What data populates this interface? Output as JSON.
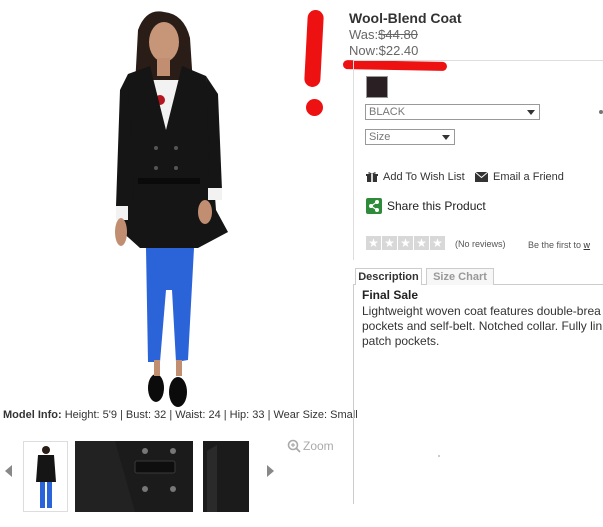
{
  "product": {
    "title": "Wool-Blend Coat",
    "was_label": "Was:",
    "was_price": "$44.80",
    "now_label": "Now:",
    "now_price": "$22.40",
    "color_select": "BLACK",
    "size_select": "Size",
    "add_to_wishlist": "Add To Wish List",
    "email_friend": "Email a Friend",
    "share": "Share this Product",
    "rating_stars": 0,
    "reviews": "(No reviews)",
    "first_to_prefix": "Be the first to",
    "first_to_link": "w"
  },
  "model_info": {
    "label": "Model Info:",
    "text": "Height: 5'9 | Bust: 32 | Waist: 24 | Hip: 33 | Wear Size: Small"
  },
  "gallery": {
    "zoom_label": "Zoom"
  },
  "tabs": [
    {
      "label": "Description",
      "active": true
    },
    {
      "label": "Size Chart",
      "active": false
    }
  ],
  "description": {
    "heading": "Final Sale",
    "lines": [
      "Lightweight woven coat features double-brea",
      "pockets and self-belt. Notched collar. Fully lin",
      "patch pockets."
    ]
  },
  "colors": {
    "annotation_red": "#ee1111",
    "swatch": "#2a1f22",
    "share_green": "#2e8b3a",
    "jeans_blue": "#2b63d8",
    "coat_black": "#151515"
  }
}
